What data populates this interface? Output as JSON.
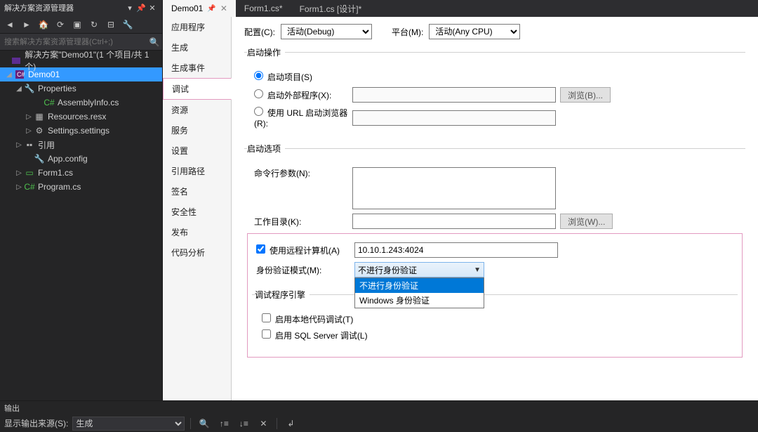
{
  "solution_explorer": {
    "title": "解决方案资源管理器",
    "search_placeholder": "搜索解决方案资源管理器(Ctrl+;)",
    "tree": {
      "solution": "解决方案\"Demo01\"(1 个项目/共 1 个)",
      "project": "Demo01",
      "properties": "Properties",
      "assemblyinfo": "AssemblyInfo.cs",
      "resources": "Resources.resx",
      "settings": "Settings.settings",
      "references": "引用",
      "appconfig": "App.config",
      "form1": "Form1.cs",
      "program": "Program.cs"
    }
  },
  "tabs": {
    "t1": "Demo01",
    "t2": "Form1.cs*",
    "t3": "Form1.cs [设计]*"
  },
  "vnav": {
    "app": "应用程序",
    "build": "生成",
    "build_events": "生成事件",
    "debug": "调试",
    "resources": "资源",
    "services": "服务",
    "settings": "设置",
    "refpaths": "引用路径",
    "signing": "签名",
    "security": "安全性",
    "publish": "发布",
    "analysis": "代码分析"
  },
  "prop": {
    "config_label": "配置(C):",
    "config_value": "活动(Debug)",
    "platform_label": "平台(M):",
    "platform_value": "活动(Any CPU)",
    "section_start": "启动操作",
    "radio_startproject": "启动项目(S)",
    "radio_external": "启动外部程序(X):",
    "radio_url": "使用 URL 启动浏览器(R):",
    "browse_b": "浏览(B)...",
    "section_options": "启动选项",
    "cmdargs_label": "命令行参数(N):",
    "workdir_label": "工作目录(K):",
    "browse_w": "浏览(W)...",
    "remote_check": "使用远程计算机(A)",
    "remote_value": "10.10.1.243:4024",
    "auth_label": "身份验证模式(M):",
    "auth_selected": "不进行身份验证",
    "auth_opt1": "不进行身份验证",
    "auth_opt2": "Windows 身份验证",
    "section_engines": "调试程序引擎",
    "native_check": "启用本地代码调试(T)",
    "sql_check": "启用 SQL Server 调试(L)"
  },
  "output": {
    "title": "输出",
    "source_label": "显示输出来源(S):",
    "source_value": "生成"
  }
}
